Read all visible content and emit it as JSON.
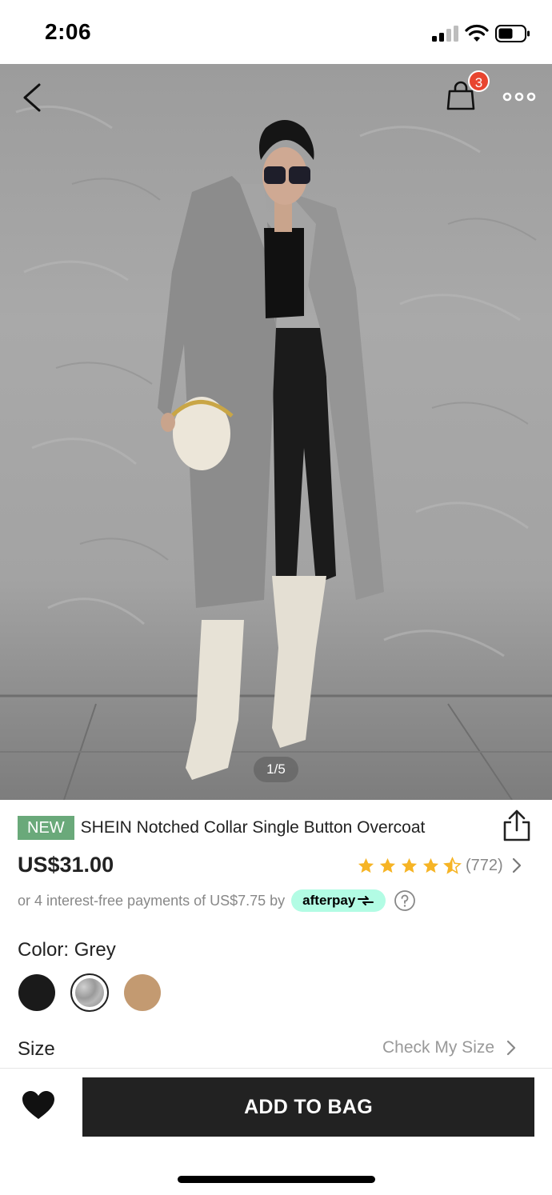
{
  "status_bar": {
    "time": "2:06"
  },
  "colors": {
    "new_badge": "#6aa97a",
    "cart_badge": "#e8452f",
    "star": "#f6b425",
    "afterpay": "#b2fce4",
    "add_button": "#222222"
  },
  "hero": {
    "pager": "1/5",
    "cart_count": "3",
    "icons": [
      "back-icon",
      "shopping-bag-icon",
      "more-icon"
    ]
  },
  "product": {
    "badge": "NEW",
    "title": "SHEIN Notched Collar Single Button Overcoat",
    "price": "US$31.00",
    "rating": 4.5,
    "rating_count": "(772)",
    "afterpay_text": "or 4 interest-free payments of US$7.75 by",
    "afterpay_logo": "afterpay"
  },
  "color": {
    "label": "Color: Grey",
    "swatches": [
      {
        "name": "Black",
        "hex": "#1a1a1a",
        "selected": false
      },
      {
        "name": "Grey",
        "hex": "#a0a0a0",
        "selected": true
      },
      {
        "name": "Camel",
        "hex": "#c39a71",
        "selected": false
      }
    ]
  },
  "size": {
    "label": "Size",
    "check_my_size": "Check My Size"
  },
  "bottom_bar": {
    "add_to_bag": "ADD TO BAG"
  }
}
